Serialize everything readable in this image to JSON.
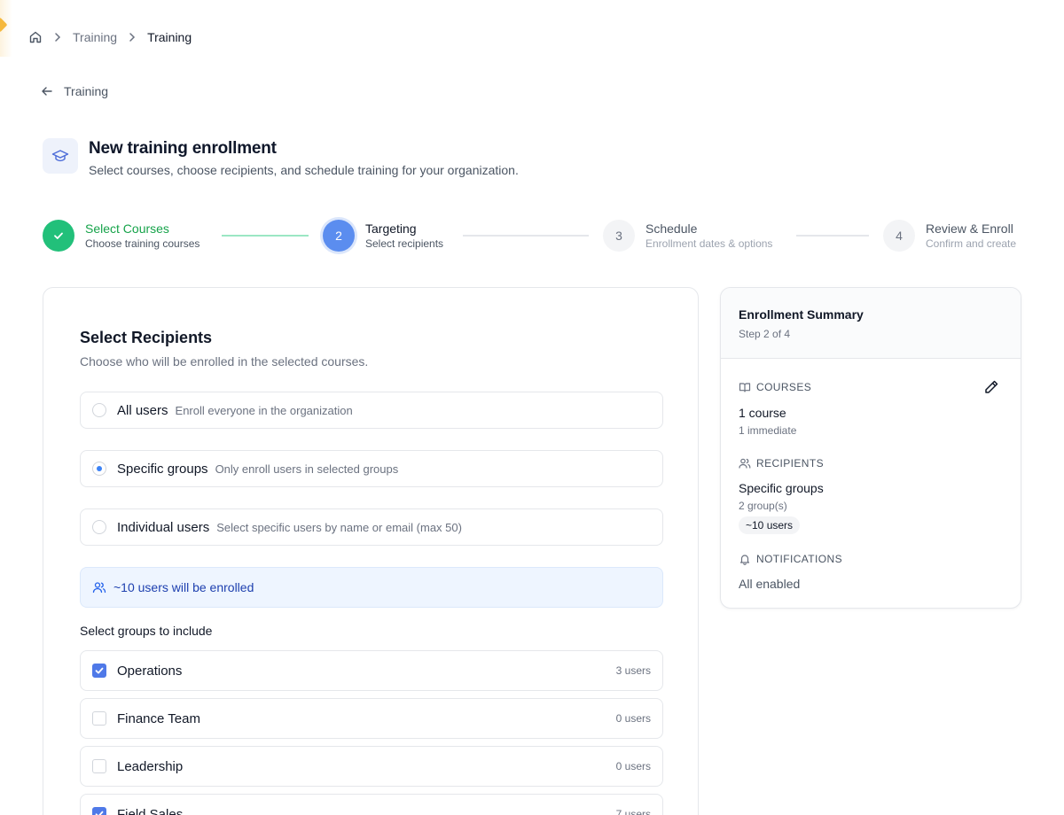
{
  "breadcrumb": {
    "items": [
      "Training",
      "Training"
    ]
  },
  "back_link": {
    "label": "Training"
  },
  "header": {
    "title": "New training enrollment",
    "subtitle": "Select courses, choose recipients, and schedule training for your organization."
  },
  "stepper": {
    "steps": [
      {
        "number": "1",
        "label": "Select Courses",
        "sub": "Choose training courses",
        "state": "done"
      },
      {
        "number": "2",
        "label": "Targeting",
        "sub": "Select recipients",
        "state": "active"
      },
      {
        "number": "3",
        "label": "Schedule",
        "sub": "Enrollment dates & options",
        "state": "pending"
      },
      {
        "number": "4",
        "label": "Review & Enroll",
        "sub": "Confirm and create",
        "state": "pending"
      }
    ]
  },
  "recipients": {
    "title": "Select Recipients",
    "subtitle": "Choose who will be enrolled in the selected courses.",
    "options": [
      {
        "label": "All users",
        "desc": "Enroll everyone in the organization",
        "selected": false
      },
      {
        "label": "Specific groups",
        "desc": "Only enroll users in selected groups",
        "selected": true
      },
      {
        "label": "Individual users",
        "desc": "Select specific users by name or email (max 50)",
        "selected": false
      }
    ],
    "info": "~10 users will be enrolled",
    "groups_title": "Select groups to include",
    "groups": [
      {
        "name": "Operations",
        "count": "3 users",
        "checked": true
      },
      {
        "name": "Finance Team",
        "count": "0 users",
        "checked": false
      },
      {
        "name": "Leadership",
        "count": "0 users",
        "checked": false
      },
      {
        "name": "Field Sales",
        "count": "7 users",
        "checked": true
      }
    ]
  },
  "summary": {
    "title": "Enrollment Summary",
    "step": "Step 2 of 4",
    "courses": {
      "label": "COURSES",
      "value": "1 course",
      "sub": "1 immediate"
    },
    "recipients": {
      "label": "RECIPIENTS",
      "value": "Specific groups",
      "sub": "2 group(s)",
      "pill": "~10 users"
    },
    "notifications": {
      "label": "NOTIFICATIONS",
      "value": "All enabled"
    }
  },
  "icons": {
    "home": "home-icon",
    "chevron": "chevron-right-icon",
    "back": "arrow-left-icon",
    "header": "graduation-cap-icon",
    "check": "check-icon",
    "users": "users-icon",
    "book": "book-open-icon",
    "bell": "bell-icon",
    "edit": "pencil-icon"
  },
  "colors": {
    "success": "#22c07a",
    "accent": "#5b8def",
    "checkbox": "#4f79e8",
    "info_bg": "#eef5ff",
    "info_text": "#1e40af"
  }
}
